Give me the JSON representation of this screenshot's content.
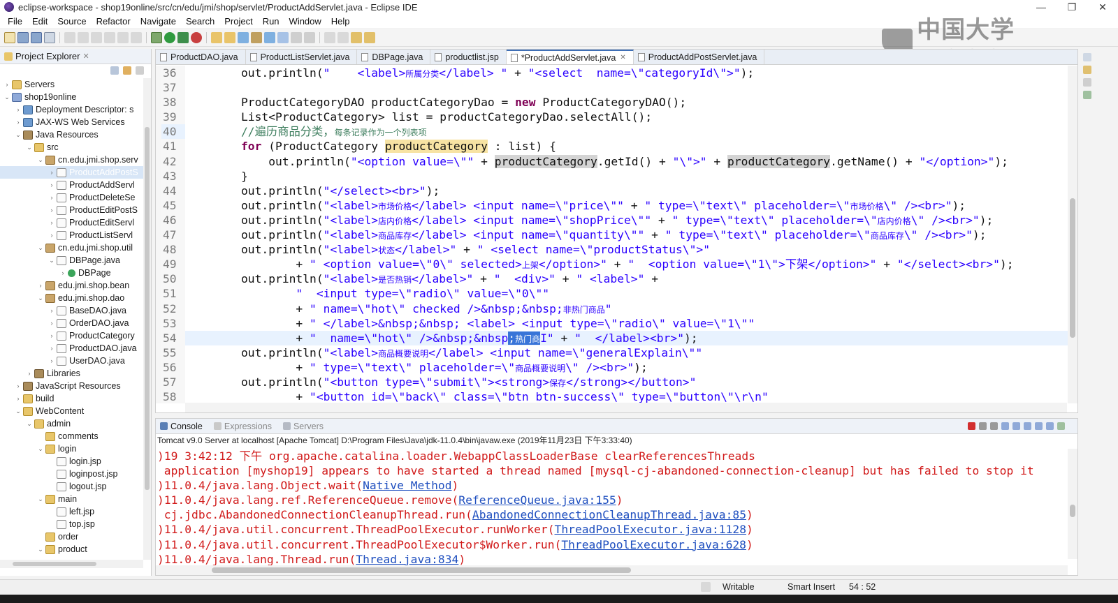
{
  "window": {
    "title": "eclipse-workspace - shop19online/src/cn/edu/jmi/shop/servlet/ProductAddServlet.java - Eclipse IDE",
    "minimize": "—",
    "restore": "❐",
    "close": "✕"
  },
  "menu": [
    "File",
    "Edit",
    "Source",
    "Refactor",
    "Navigate",
    "Search",
    "Project",
    "Run",
    "Window",
    "Help"
  ],
  "watermark": "中国大学MOOC",
  "explorer": {
    "title": "Project Explorer",
    "close": "✕",
    "items": [
      {
        "label": "Servers",
        "depth": 0,
        "tw": "›",
        "icon": "folder"
      },
      {
        "label": "shop19online",
        "depth": 0,
        "tw": "⌄",
        "icon": "project"
      },
      {
        "label": "Deployment Descriptor: s",
        "depth": 1,
        "tw": "›",
        "icon": "web"
      },
      {
        "label": "JAX-WS Web Services",
        "depth": 1,
        "tw": "›",
        "icon": "web"
      },
      {
        "label": "Java Resources",
        "depth": 1,
        "tw": "⌄",
        "icon": "lib"
      },
      {
        "label": "src",
        "depth": 2,
        "tw": "⌄",
        "icon": "folder"
      },
      {
        "label": "cn.edu.jmi.shop.serv",
        "depth": 3,
        "tw": "⌄",
        "icon": "pkg"
      },
      {
        "label": "ProductAddPostS",
        "depth": 4,
        "tw": "›",
        "icon": "java",
        "selected": true
      },
      {
        "label": "ProductAddServl",
        "depth": 4,
        "tw": "›",
        "icon": "java"
      },
      {
        "label": "ProductDeleteSe",
        "depth": 4,
        "tw": "›",
        "icon": "java"
      },
      {
        "label": "ProductEditPostS",
        "depth": 4,
        "tw": "›",
        "icon": "java"
      },
      {
        "label": "ProductEditServl",
        "depth": 4,
        "tw": "›",
        "icon": "java"
      },
      {
        "label": "ProductListServl",
        "depth": 4,
        "tw": "›",
        "icon": "java"
      },
      {
        "label": "cn.edu.jmi.shop.util",
        "depth": 3,
        "tw": "⌄",
        "icon": "pkg"
      },
      {
        "label": "DBPage.java",
        "depth": 4,
        "tw": "⌄",
        "icon": "java"
      },
      {
        "label": "DBPage",
        "depth": 5,
        "tw": "›",
        "icon": "class"
      },
      {
        "label": "edu.jmi.shop.bean",
        "depth": 3,
        "tw": "›",
        "icon": "pkg"
      },
      {
        "label": "edu.jmi.shop.dao",
        "depth": 3,
        "tw": "⌄",
        "icon": "pkg"
      },
      {
        "label": "BaseDAO.java",
        "depth": 4,
        "tw": "›",
        "icon": "java"
      },
      {
        "label": "OrderDAO.java",
        "depth": 4,
        "tw": "›",
        "icon": "java"
      },
      {
        "label": "ProductCategory",
        "depth": 4,
        "tw": "›",
        "icon": "java"
      },
      {
        "label": "ProductDAO.java",
        "depth": 4,
        "tw": "›",
        "icon": "java"
      },
      {
        "label": "UserDAO.java",
        "depth": 4,
        "tw": "›",
        "icon": "java"
      },
      {
        "label": "Libraries",
        "depth": 2,
        "tw": "›",
        "icon": "lib"
      },
      {
        "label": "JavaScript Resources",
        "depth": 1,
        "tw": "›",
        "icon": "lib"
      },
      {
        "label": "build",
        "depth": 1,
        "tw": "›",
        "icon": "folder"
      },
      {
        "label": "WebContent",
        "depth": 1,
        "tw": "⌄",
        "icon": "folder"
      },
      {
        "label": "admin",
        "depth": 2,
        "tw": "⌄",
        "icon": "folder"
      },
      {
        "label": "comments",
        "depth": 3,
        "tw": "",
        "icon": "folder"
      },
      {
        "label": "login",
        "depth": 3,
        "tw": "⌄",
        "icon": "folder"
      },
      {
        "label": "login.jsp",
        "depth": 4,
        "tw": "",
        "icon": "jsp"
      },
      {
        "label": "loginpost.jsp",
        "depth": 4,
        "tw": "",
        "icon": "jsp"
      },
      {
        "label": "logout.jsp",
        "depth": 4,
        "tw": "",
        "icon": "jsp"
      },
      {
        "label": "main",
        "depth": 3,
        "tw": "⌄",
        "icon": "folder"
      },
      {
        "label": "left.jsp",
        "depth": 4,
        "tw": "",
        "icon": "jsp"
      },
      {
        "label": "top.jsp",
        "depth": 4,
        "tw": "",
        "icon": "jsp"
      },
      {
        "label": "order",
        "depth": 3,
        "tw": "",
        "icon": "folder"
      },
      {
        "label": "product",
        "depth": 3,
        "tw": "⌄",
        "icon": "folder"
      }
    ]
  },
  "editor": {
    "tabs": [
      {
        "label": "ProductDAO.java",
        "active": false
      },
      {
        "label": "ProductListServlet.java",
        "active": false
      },
      {
        "label": "DBPage.java",
        "active": false
      },
      {
        "label": "productlist.jsp",
        "active": false
      },
      {
        "label": "*ProductAddServlet.java",
        "active": true
      },
      {
        "label": "ProductAddPostServlet.java",
        "active": false
      }
    ],
    "current_line": "40",
    "lines": [
      {
        "n": "36",
        "html": "out.println(<span class=\"st\">\"    &lt;label&gt;<span class=\"cjk\">所属分类</span>&lt;/label&gt; \"</span> + <span class=\"st\">\"&lt;select  name=\\\"categoryId\\\"&gt;\"</span>);"
      },
      {
        "n": "37",
        "html": ""
      },
      {
        "n": "38",
        "html": "ProductCategoryDAO productCategoryDao = <span class=\"kw\">new</span> ProductCategoryDAO();"
      },
      {
        "n": "39",
        "html": "List&lt;ProductCategory&gt; list = productCategoryDao.selectAll();"
      },
      {
        "n": "40",
        "html": "<span class=\"cm\">//遍历商品分类，<span class=\"cjk\">每条记录作为一个列表项</span></span>"
      },
      {
        "n": "41",
        "html": "<span class=\"kw\">for</span> (ProductCategory <span class=\"hlo\">productCategory</span> : list) {"
      },
      {
        "n": "42",
        "html": "    out.println(<span class=\"st\">\"&lt;option value=\\\"\"</span> + <span class=\"hl\">productCategory</span>.getId() + <span class=\"st\">\"\\\"&gt;\"</span> + <span class=\"hl\">productCategory</span>.getName() + <span class=\"st\">\"&lt;/option&gt;\"</span>);"
      },
      {
        "n": "43",
        "html": "}"
      },
      {
        "n": "44",
        "html": "out.println(<span class=\"st\">\"&lt;/select&gt;&lt;br&gt;\"</span>);"
      },
      {
        "n": "45",
        "html": "out.println(<span class=\"st\">\"&lt;label&gt;<span class=\"cjk\">市场价格</span>&lt;/label&gt; &lt;input name=\\\"price\\\"\"</span> + <span class=\"st\">\" type=\\\"text\\\" placeholder=\\\"<span class=\"cjk\">市场价格</span>\\\" /&gt;&lt;br&gt;\"</span>);"
      },
      {
        "n": "46",
        "html": "out.println(<span class=\"st\">\"&lt;label&gt;<span class=\"cjk\">店内价格</span>&lt;/label&gt; &lt;input name=\\\"shopPrice\\\"\"</span> + <span class=\"st\">\" type=\\\"text\\\" placeholder=\\\"<span class=\"cjk\">店内价格</span>\\\" /&gt;&lt;br&gt;\"</span>);"
      },
      {
        "n": "47",
        "html": "out.println(<span class=\"st\">\"&lt;label&gt;<span class=\"cjk\">商品库存</span>&lt;/label&gt; &lt;input name=\\\"quantity\\\"\"</span> + <span class=\"st\">\" type=\\\"text\\\" placeholder=\\\"<span class=\"cjk\">商品库存</span>\\\" /&gt;&lt;br&gt;\"</span>);"
      },
      {
        "n": "48",
        "html": "out.println(<span class=\"st\">\"&lt;label&gt;<span class=\"cjk\">状态</span>&lt;/label&gt;\"</span> + <span class=\"st\">\" &lt;select name=\\\"productStatus\\\"&gt;\"</span>"
      },
      {
        "n": "49",
        "html": "        + <span class=\"st\">\" &lt;option value=\\\"0\\\" selected&gt;<span class=\"cjk\">上架</span>&lt;/option&gt;\"</span> + <span class=\"st\">\"  &lt;option value=\\\"1\\\"&gt;下架&lt;/option&gt;\"</span> + <span class=\"st\">\"&lt;/select&gt;&lt;br&gt;\"</span>);"
      },
      {
        "n": "50",
        "html": "out.println(<span class=\"st\">\"&lt;label&gt;<span class=\"cjk\">是否热销</span>&lt;/label&gt;\"</span> + <span class=\"st\">\"  &lt;div&gt;\"</span> + <span class=\"st\">\" &lt;label&gt;\"</span> +"
      },
      {
        "n": "51",
        "html": "        <span class=\"st\">\"  &lt;input type=\\\"radio\\\" value=\\\"0\\\"\"</span>"
      },
      {
        "n": "52",
        "html": "        + <span class=\"st\">\" name=\\\"hot\\\" checked /&gt;&amp;nbsp;&amp;nbsp;<span class=\"cjk\">非热门商品</span>\"</span>"
      },
      {
        "n": "53",
        "html": "        + <span class=\"st\">\" &lt;/label&gt;&amp;nbsp;&amp;nbsp; &lt;label&gt; &lt;input type=\\\"radio\\\" value=\\\"1\\\"\"</span>"
      },
      {
        "n": "54",
        "html": "        + <span class=\"st\">\"  name=\\\"hot\\\" /&gt;&amp;nbsp;&amp;nbsp<span class=\"sel\">;<span class=\"cjk\">热门商</span></span>I\"</span> + <span class=\"st\">\"  &lt;/label&gt;&lt;br&gt;\"</span>);"
      },
      {
        "n": "55",
        "html": "out.println(<span class=\"st\">\"&lt;label&gt;<span class=\"cjk\">商品概要说明</span>&lt;/label&gt; &lt;input name=\\\"generalExplain\\\"\"</span>"
      },
      {
        "n": "56",
        "html": "        + <span class=\"st\">\" type=\\\"text\\\" placeholder=\\\"<span class=\"cjk\">商品概要说明</span>\\\" /&gt;&lt;br&gt;\"</span>);"
      },
      {
        "n": "57",
        "html": "out.println(<span class=\"st\">\"&lt;button type=\\\"submit\\\"&gt;&lt;strong&gt;<span class=\"cjk\">保存</span>&lt;/strong&gt;&lt;/button&gt;\"</span>"
      },
      {
        "n": "58",
        "html": "        + <span class=\"st\">\"&lt;button id=\\\"back\\\" class=\\\"btn btn-success\\\" type=\\\"button\\\"\\r\\n\"</span>"
      }
    ]
  },
  "console": {
    "tabs": [
      {
        "label": "Console",
        "active": true
      },
      {
        "label": "Expressions",
        "active": false
      },
      {
        "label": "Servers",
        "active": false
      }
    ],
    "header": "Tomcat v9.0 Server at localhost [Apache Tomcat] D:\\Program Files\\Java\\jdk-11.0.4\\bin\\javaw.exe (2019年11月23日 下午3:33:40)",
    "lines": [
      {
        "text": ")19 3:42:12 下午 org.apache.catalina.loader.WebappClassLoaderBase clearReferencesThreads",
        "link": "",
        "tail": ""
      },
      {
        "text": " application [myshop19] appears to have started a thread named [mysql-cj-abandoned-connection-cleanup] but has failed to stop it",
        "link": "",
        "tail": ""
      },
      {
        "text": ")11.0.4/java.lang.Object.wait(",
        "link": "Native Method",
        "tail": ")"
      },
      {
        "text": ")11.0.4/java.lang.ref.ReferenceQueue.remove(",
        "link": "ReferenceQueue.java:155",
        "tail": ")"
      },
      {
        "text": " cj.jdbc.AbandonedConnectionCleanupThread.run(",
        "link": "AbandonedConnectionCleanupThread.java:85",
        "tail": ")"
      },
      {
        "text": ")11.0.4/java.util.concurrent.ThreadPoolExecutor.runWorker(",
        "link": "ThreadPoolExecutor.java:1128",
        "tail": ")"
      },
      {
        "text": ")11.0.4/java.util.concurrent.ThreadPoolExecutor$Worker.run(",
        "link": "ThreadPoolExecutor.java:628",
        "tail": ")"
      },
      {
        "text": ")11.0.4/java.lang.Thread.run(",
        "link": "Thread.java:834",
        "tail": ")"
      }
    ]
  },
  "status": {
    "writable": "Writable",
    "insert_mode": "Smart Insert",
    "position": "54 : 52"
  },
  "colors": {
    "keyword": "#7f0055",
    "string": "#2a00ff",
    "comment": "#3f7f5f",
    "console_error": "#d11a1a",
    "link": "#1f4fbf",
    "selection": "#3874d8"
  }
}
